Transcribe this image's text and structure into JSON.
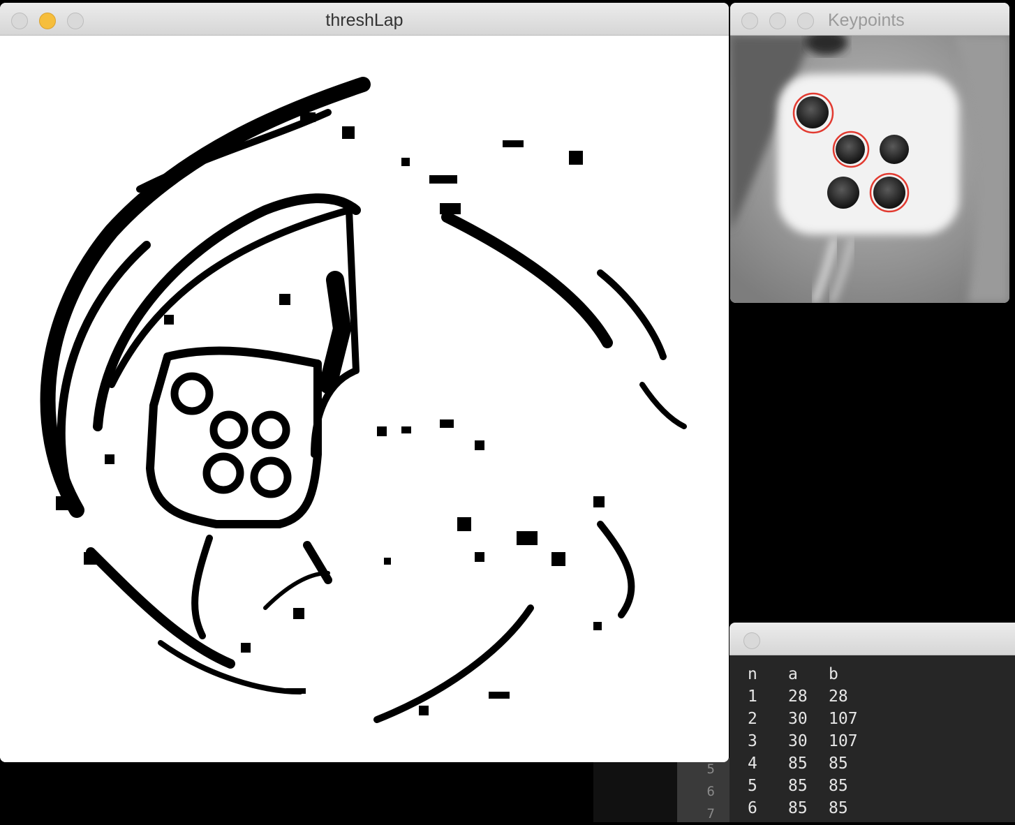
{
  "windows": {
    "thresh": {
      "title": "threshLap"
    },
    "keypoints": {
      "title": "Keypoints"
    },
    "console": {
      "headers": [
        "n",
        "a",
        "b"
      ],
      "rows": [
        [
          "1",
          "28",
          "28"
        ],
        [
          "2",
          "30",
          "107"
        ],
        [
          "3",
          "30",
          "107"
        ],
        [
          "4",
          "85",
          "85"
        ],
        [
          "5",
          "85",
          "85"
        ],
        [
          "6",
          "85",
          "85"
        ]
      ]
    }
  },
  "editor_gutter": {
    "line_numbers": [
      "5",
      "6",
      "7"
    ]
  },
  "colors": {
    "keypoint_circle": "#e23a30",
    "background": "#000000",
    "console_bg": "#262626"
  }
}
